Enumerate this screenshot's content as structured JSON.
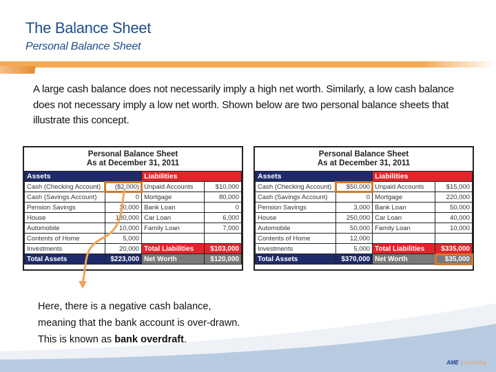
{
  "header": {
    "title": "The Balance Sheet",
    "subtitle": "Personal Balance Sheet"
  },
  "intro_text": "A large cash balance does not necessarily imply a high net worth. Similarly, a low cash balance does not necessary imply a low net worth. Shown below are two personal balance sheets that illustrate this concept.",
  "colors": {
    "title_blue": "#1d4e89",
    "accent_orange": "#f7a852",
    "assets_navy": "#1f2a6b",
    "liabilities_red": "#e2252b",
    "net_worth_gray": "#7a7a7a",
    "highlight_orange": "#d07a2a"
  },
  "sheets": [
    {
      "title": "Personal Balance Sheet",
      "date_line": "As at December 31, 2011",
      "assets_header": "Assets",
      "liabilities_header": "Liabilities",
      "rows": [
        {
          "asset": "Cash (Checking Account)",
          "asset_value": "($2,000)",
          "liability": "Unpaid Accounts",
          "liability_value": "$10,000"
        },
        {
          "asset": "Cash (Savings Account)",
          "asset_value": "0",
          "liability": "Mortgage",
          "liability_value": "80,000"
        },
        {
          "asset": "Pension Savings",
          "asset_value": "10,000",
          "liability": "Bank Loan",
          "liability_value": "0"
        },
        {
          "asset": "House",
          "asset_value": "180,000",
          "liability": "Car Loan",
          "liability_value": "6,000"
        },
        {
          "asset": "Automobile",
          "asset_value": "10,000",
          "liability": "Family Loan",
          "liability_value": "7,000"
        },
        {
          "asset": "Contents of Home",
          "asset_value": "5,000",
          "liability": "",
          "liability_value": ""
        },
        {
          "asset": "Investments",
          "asset_value": "20,000",
          "liability": "Total Liabilities",
          "liability_value": "$103,000"
        }
      ],
      "total_assets_label": "Total Assets",
      "total_assets_value": "$223,000",
      "net_worth_label": "Net Worth",
      "net_worth_value": "$120,000"
    },
    {
      "title": "Personal Balance Sheet",
      "date_line": "As at December 31, 2011",
      "assets_header": "Assets",
      "liabilities_header": "Liabilities",
      "rows": [
        {
          "asset": "Cash (Checking Account)",
          "asset_value": "$50,000",
          "liability": "Unpaid Accounts",
          "liability_value": "$15,000"
        },
        {
          "asset": "Cash (Savings Account)",
          "asset_value": "0",
          "liability": "Mortgage",
          "liability_value": "220,000"
        },
        {
          "asset": "Pension Savings",
          "asset_value": "3,000",
          "liability": "Bank Loan",
          "liability_value": "50,000"
        },
        {
          "asset": "House",
          "asset_value": "250,000",
          "liability": "Car Loan",
          "liability_value": "40,000"
        },
        {
          "asset": "Automobile",
          "asset_value": "50,000",
          "liability": "Family Loan",
          "liability_value": "10,000"
        },
        {
          "asset": "Contents of Home",
          "asset_value": "12,000",
          "liability": "",
          "liability_value": ""
        },
        {
          "asset": "Investments",
          "asset_value": "5,000",
          "liability": "Total Liabilities",
          "liability_value": "$335,000"
        }
      ],
      "total_assets_label": "Total Assets",
      "total_assets_value": "$370,000",
      "net_worth_label": "Net Worth",
      "net_worth_value": "$35,000"
    }
  ],
  "note": {
    "line1": "Here, there is a negative cash balance,",
    "line2": "meaning that the bank account is over-drawn.",
    "line3_prefix": "This is known as ",
    "line3_bold": "bank overdraft",
    "line3_suffix": "."
  },
  "logo": {
    "brand": "AME",
    "tagline": "Learning"
  }
}
